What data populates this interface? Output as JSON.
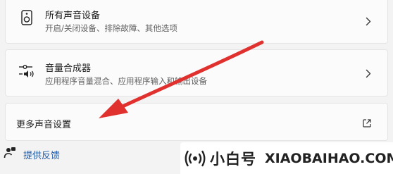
{
  "sound_settings": {
    "all_devices": {
      "title": "所有声音设备",
      "description": "开启/关闭设备、排除故障、其他选项",
      "icon": "speaker-icon"
    },
    "volume_mixer": {
      "title": "音量合成器",
      "description": "应用程序音量混合、应用程序输入和输出设备",
      "icon": "mixer-icon"
    },
    "more_settings": {
      "title": "更多声音设置",
      "icon": "external-link-icon"
    }
  },
  "feedback": {
    "label": "提供反馈",
    "icon": "feedback-icon"
  },
  "annotation": {
    "arrow_color": "#e0312e"
  },
  "watermark": {
    "name": "小白号",
    "url": "XIAOBAIHAO.COM"
  }
}
